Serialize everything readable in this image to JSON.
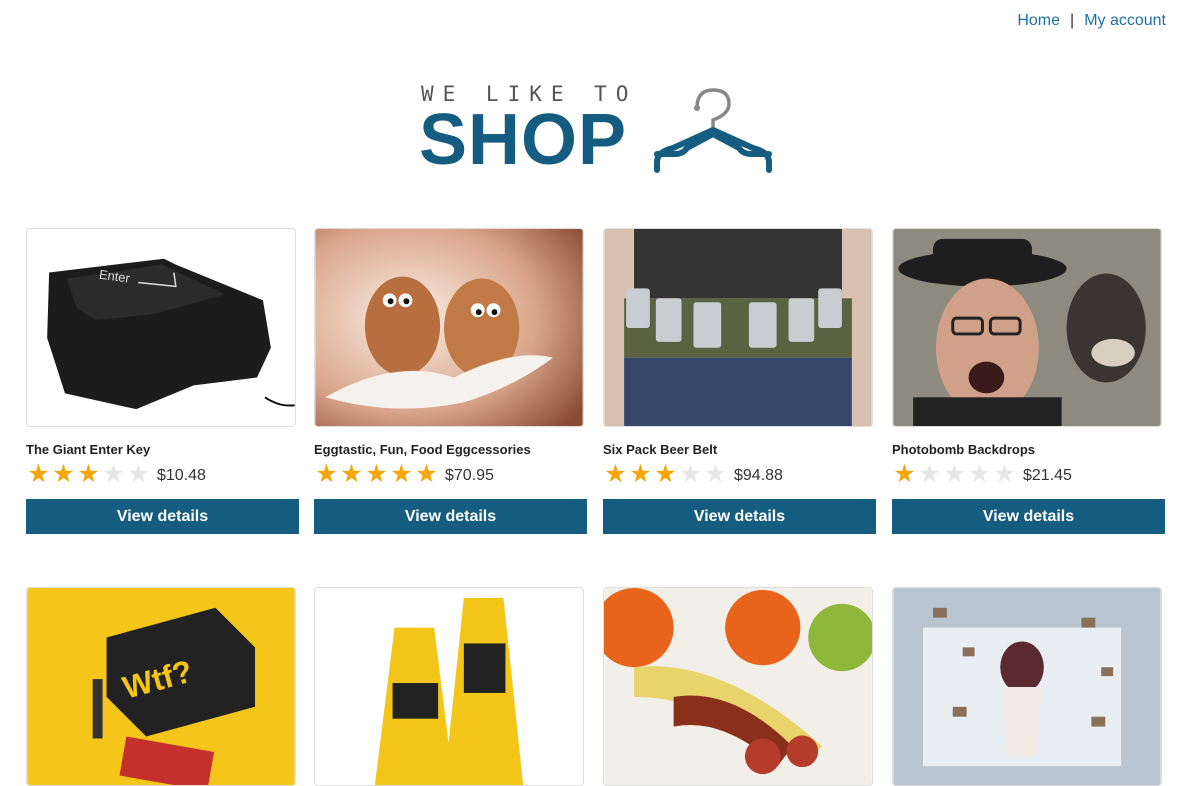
{
  "nav": {
    "home": "Home",
    "separator": "|",
    "account": "My account"
  },
  "logo": {
    "tagline": "WE LIKE TO",
    "wordmark": "SHOP",
    "icon": "hanger-icon",
    "color": "#155d80"
  },
  "colors": {
    "button": "#155d80",
    "star_on": "#f7a500",
    "star_off": "#e6e6e6",
    "link": "#1f6fa6"
  },
  "products": [
    {
      "name": "The Giant Enter Key",
      "rating": 3,
      "price": "$10.48",
      "button": "View details"
    },
    {
      "name": "Eggtastic, Fun, Food Eggcessories",
      "rating": 5,
      "price": "$70.95",
      "button": "View details"
    },
    {
      "name": "Six Pack Beer Belt",
      "rating": 3,
      "price": "$94.88",
      "button": "View details"
    },
    {
      "name": "Photobomb Backdrops",
      "rating": 1,
      "price": "$21.45",
      "button": "View details"
    },
    {
      "name": "",
      "rating": null,
      "price": "",
      "button": ""
    },
    {
      "name": "",
      "rating": null,
      "price": "",
      "button": ""
    },
    {
      "name": "",
      "rating": null,
      "price": "",
      "button": ""
    },
    {
      "name": "",
      "rating": null,
      "price": "",
      "button": ""
    }
  ]
}
